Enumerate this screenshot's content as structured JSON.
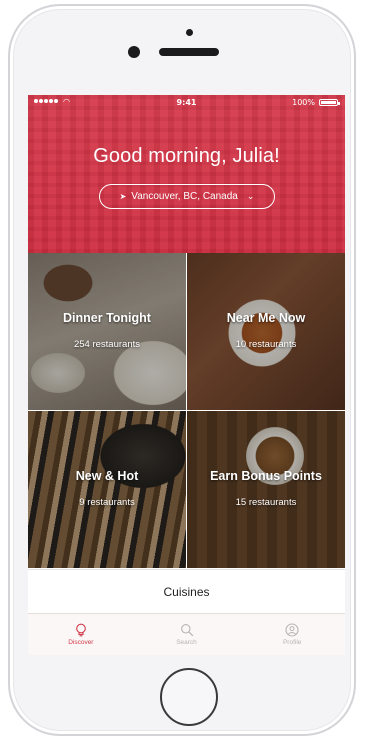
{
  "status": {
    "time": "9:41",
    "battery": "100%"
  },
  "header": {
    "greeting": "Good morning, Julia!",
    "location": "Vancouver, BC, Canada"
  },
  "tiles": [
    {
      "title": "Dinner Tonight",
      "count": "254 restaurants"
    },
    {
      "title": "Near Me Now",
      "count": "10 restaurants"
    },
    {
      "title": "New & Hot",
      "count": "9 restaurants"
    },
    {
      "title": "Earn Bonus Points",
      "count": "15 restaurants"
    }
  ],
  "cuisines_label": "Cuisines",
  "tabs": [
    {
      "label": "Discover",
      "icon": "lightbulb-icon",
      "active": true
    },
    {
      "label": "Search",
      "icon": "search-icon",
      "active": false
    },
    {
      "label": "Profile",
      "icon": "profile-icon",
      "active": false
    }
  ],
  "colors": {
    "brand_red": "#d23a4b",
    "inactive_tab": "#b9b3b3"
  }
}
